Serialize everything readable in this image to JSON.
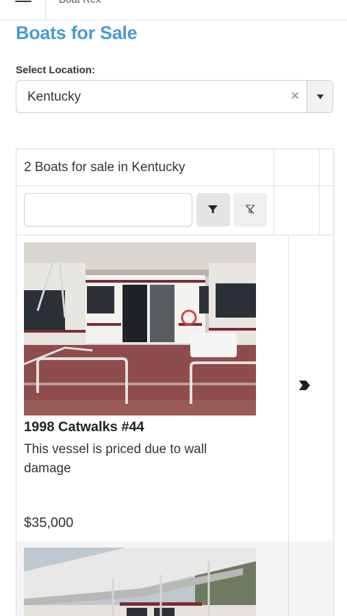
{
  "header": {
    "brand": "Boat Rex"
  },
  "page": {
    "title": "Boats for Sale"
  },
  "location": {
    "label": "Select Location:",
    "value": "Kentucky",
    "clear_symbol": "×"
  },
  "table": {
    "count_text": "2 Boats for sale in Kentucky",
    "filter": {
      "value": "",
      "placeholder": ""
    },
    "rows": [
      {
        "title": "1998 Catwalks #44",
        "description": "This vessel is priced due to wall damage",
        "price": "$35,000"
      }
    ]
  },
  "icons": {
    "menu": "hamburger-icon",
    "filter": "funnel-icon",
    "clear_filter": "clear-filter-icon",
    "select_arrow": "caret-down-icon",
    "row_open": "chevron-right-icon"
  },
  "colors": {
    "title": "#4a9bd0"
  }
}
